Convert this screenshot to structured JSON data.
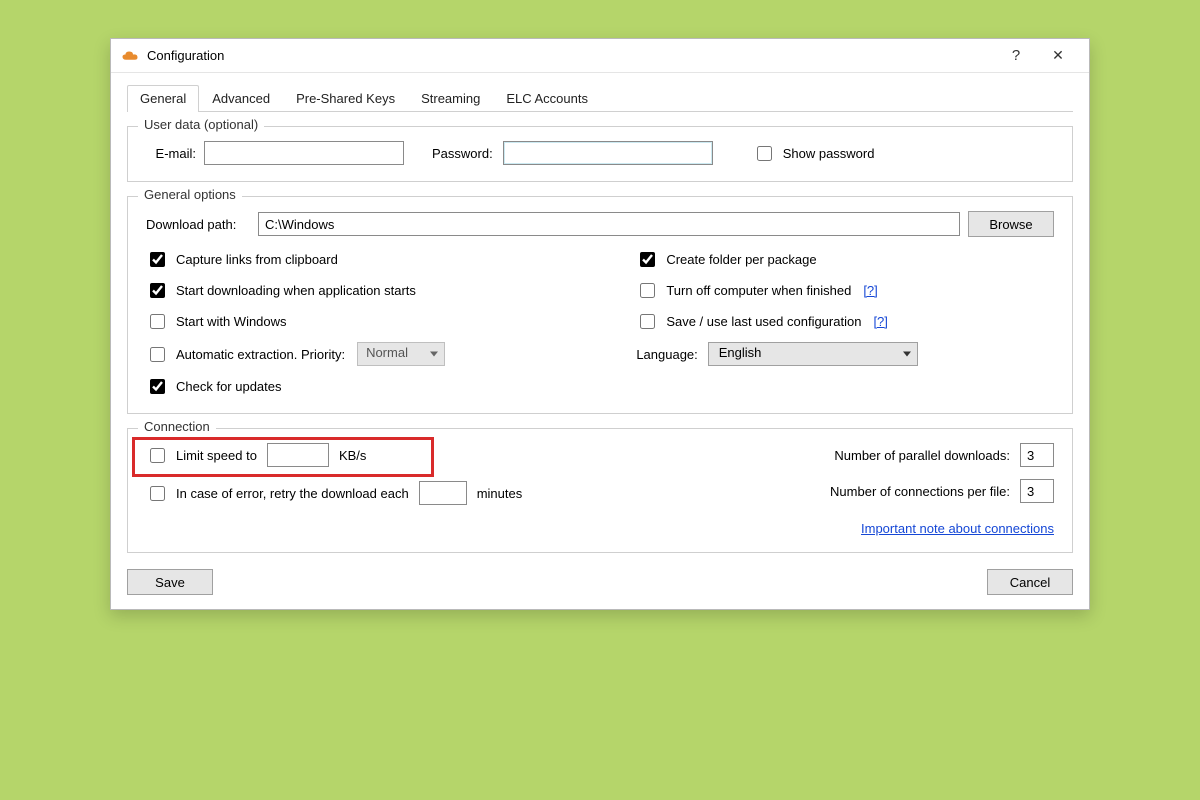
{
  "window": {
    "title": "Configuration",
    "help_glyph": "?",
    "close_glyph": "✕"
  },
  "tabs": [
    {
      "label": "General",
      "active": true
    },
    {
      "label": "Advanced"
    },
    {
      "label": "Pre-Shared Keys"
    },
    {
      "label": "Streaming"
    },
    {
      "label": "ELC Accounts"
    }
  ],
  "user_data": {
    "legend": "User data (optional)",
    "email_label": "E-mail:",
    "email_value": "",
    "password_label": "Password:",
    "password_value": "",
    "show_password_label": "Show password",
    "show_password_checked": false
  },
  "general_options": {
    "legend": "General options",
    "download_path_label": "Download path:",
    "download_path_value": "C:\\Windows",
    "browse_label": "Browse",
    "left": {
      "capture_label": "Capture links from clipboard",
      "capture_checked": true,
      "start_dl_label": "Start downloading when application starts",
      "start_dl_checked": true,
      "start_win_label": "Start with Windows",
      "start_win_checked": false,
      "auto_extract_label": "Automatic extraction. Priority:",
      "auto_extract_checked": false,
      "priority_value": "Normal",
      "check_updates_label": "Check for updates",
      "check_updates_checked": true
    },
    "right": {
      "create_folder_label": "Create folder per package",
      "create_folder_checked": true,
      "turnoff_label": "Turn off computer when finished",
      "turnoff_checked": false,
      "save_last_label": "Save / use last used configuration",
      "save_last_checked": false,
      "help_glyph": "[?]",
      "language_label": "Language:",
      "language_value": "English"
    }
  },
  "connection": {
    "legend": "Connection",
    "limit_speed_label": "Limit speed to",
    "limit_speed_checked": false,
    "limit_speed_value": "",
    "kbs_label": "KB/s",
    "retry_label": "In case of error, retry the download each",
    "retry_checked": false,
    "retry_value": "",
    "minutes_label": "minutes",
    "parallel_label": "Number of parallel downloads:",
    "parallel_value": "3",
    "connections_label": "Number of connections per file:",
    "connections_value": "3",
    "note_link": "Important note about connections"
  },
  "footer": {
    "save_label": "Save",
    "cancel_label": "Cancel"
  }
}
